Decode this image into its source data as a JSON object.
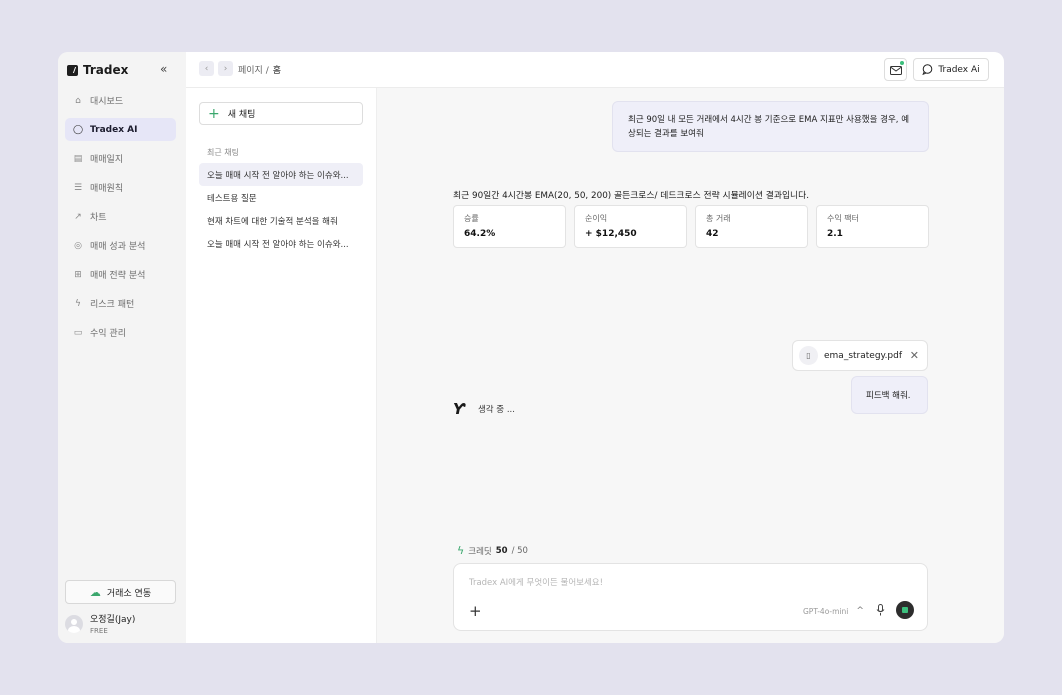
{
  "app": {
    "name": "Tradex"
  },
  "sidebar": {
    "collapse_label": "«",
    "items": [
      {
        "label": "대시보드",
        "icon": "⌂"
      },
      {
        "label": "Tradex AI",
        "icon": "◯"
      },
      {
        "label": "매매일지",
        "icon": "▤"
      },
      {
        "label": "매매원칙",
        "icon": "☰"
      },
      {
        "label": "차트",
        "icon": "↗"
      },
      {
        "label": "매매 성과 분석",
        "icon": "◎"
      },
      {
        "label": "매매 전략 분석",
        "icon": "⊞"
      },
      {
        "label": "리스크 패턴",
        "icon": "ϟ"
      },
      {
        "label": "수익 관리",
        "icon": "▭"
      }
    ],
    "exchange_button": "거래소 연동",
    "user": {
      "name": "오정길(Jay)",
      "plan": "FREE"
    }
  },
  "header": {
    "breadcrumb_parent": "페이지 /",
    "breadcrumb_current": "홈",
    "tradex_ai_button": "Tradex Ai"
  },
  "chatlist": {
    "new_chat": "새 채팅",
    "recent_title": "최근 채팅",
    "items": [
      "오늘 매매 시작 전 알아야 하는 이슈와...",
      "테스트용 질문",
      "현재 차트에 대한 기술적 분석을 해줘",
      "오늘 매매 시작 전 알아야 하는 이슈와..."
    ]
  },
  "conversation": {
    "user_message_1": "최근 90일 내 모든 거래에서 4시간 봉 기준으로 EMA 지표만 사용했을 경우, 예상되는 결과를 보여줘",
    "response_text": "최근 90일간 4시간봉 EMA(20, 50, 200) 골든크로스/ 데드크로스 전략 시뮬레이션 결과입니다.",
    "stats": [
      {
        "label": "승률",
        "value": "64.2%"
      },
      {
        "label": "순이익",
        "value": "+ $12,450"
      },
      {
        "label": "총 거래",
        "value": "42"
      },
      {
        "label": "수익 팩터",
        "value": "2.1"
      }
    ],
    "attachment": "ema_strategy.pdf",
    "user_message_2": "피드백 해줘.",
    "thinking": "생각 중 ..."
  },
  "composer": {
    "credit_label": "크레딧",
    "credit_remaining": "50",
    "credit_total": "/ 50",
    "placeholder": "Tradex AI에게 무엇이든 물어보세요!",
    "model": "GPT-4o-mini"
  },
  "colors": {
    "accent": "#3aa76d",
    "active_bg": "#e6e6f7"
  }
}
